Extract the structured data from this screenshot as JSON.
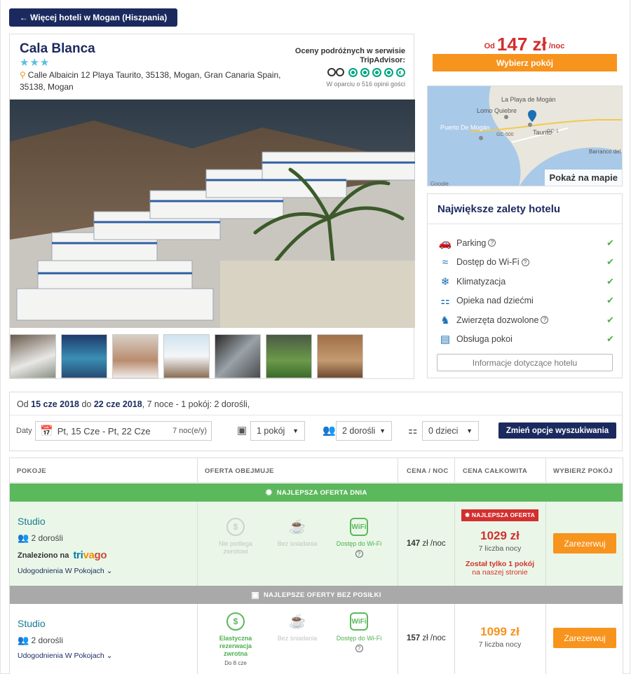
{
  "nav": {
    "back_label": "← Więcej hoteli w Mogan (Hiszpania)"
  },
  "hotel": {
    "name": "Cala Blanca",
    "stars": "★★★",
    "address": "Calle Albaicin 12 Playa Taurito, 35138, Mogan, Gran Canaria Spain, 35138, Mogan",
    "tripadvisor_title": "Oceny podróżnych w serwisie TripAdvisor:",
    "tripadvisor_rating": 4.5,
    "tripadvisor_sub": "W oparciu o 516 opinii gości"
  },
  "price_panel": {
    "prefix": "Od",
    "amount": "147 zł",
    "suffix": "/noc",
    "choose_label": "Wybierz pokój"
  },
  "map": {
    "show_label": "Pokaż na mapie",
    "labels": [
      "La Playa de Mogán",
      "Lomo Quiebre",
      "Puerto De Mogán",
      "Taurito",
      "Barranco del Cura",
      "GC-500",
      "GC-1",
      "Google"
    ]
  },
  "features": {
    "title": "Największe zalety hotelu",
    "items": [
      {
        "icon": "car-icon",
        "label": "Parking",
        "help": true
      },
      {
        "icon": "wifi-icon",
        "label": "Dostęp do Wi-Fi",
        "help": true
      },
      {
        "icon": "snowflake-icon",
        "label": "Klimatyzacja",
        "help": false
      },
      {
        "icon": "stroller-icon",
        "label": "Opieka nad dziećmi",
        "help": false
      },
      {
        "icon": "dog-icon",
        "label": "Zwierzęta dozwolone",
        "help": true
      },
      {
        "icon": "room-service-icon",
        "label": "Obsługa pokoi",
        "help": false
      }
    ],
    "info_button": "Informacje dotyczące hotelu"
  },
  "search": {
    "summary_prefix": "Od",
    "from_date": "15 cze 2018",
    "to_word": "do",
    "to_date": "22 cze 2018",
    "summary_rest": ", 7 noce - 1 pokój: 2 dorośli,",
    "dates_label": "Daty",
    "dates_value": "Pt, 15 Cze - Pt, 22 Cze",
    "nights_value": "7 noc(e/y)",
    "rooms_value": "1 pokój",
    "adults_value": "2 dorośli",
    "children_value": "0 dzieci",
    "change_button": "Zmień opcje wyszukiwania"
  },
  "table": {
    "headers": [
      "POKOJE",
      "OFERTA OBEJMUJE",
      "CENA / NOC",
      "CENA CAŁKOWITA",
      "WYBIERZ POKÓJ"
    ],
    "band_best_day": "NAJLEPSZA OFERTA DNIA",
    "band_no_meal": "NAJLEPSZE OFERTY BEZ POSIŁKI",
    "rows": [
      {
        "room": "Studio",
        "people": "2 dorośli",
        "found_on": "Znaleziono na",
        "found_brand": "trivago",
        "amenities_link": "Udogodnienia W Pokojach",
        "offer1": "Nie podlega zwrotowi",
        "offer2": "Bez śniadania",
        "offer3": "Dostęp do Wi-Fi",
        "price_night": "147",
        "price_night_unit": "zł /noc",
        "best_tag": "NAJLEPSZA OFERTA",
        "total": "1029 zł",
        "nights": "7 liczba nocy",
        "only_left": "Został tylko 1 pokój",
        "on_site": "na naszej stronie",
        "book": "Zarezerwuj"
      },
      {
        "room": "Studio",
        "people": "2 dorośli",
        "amenities_link": "Udogodnienia W Pokojach",
        "offer1": "Elastyczna rezerwacja zwrotna",
        "offer1_sub": "Do 8 cze",
        "offer2": "Bez śniadania",
        "offer3": "Dostęp do Wi-Fi",
        "price_night": "157",
        "price_night_unit": "zł /noc",
        "total": "1099 zł",
        "nights": "7 liczba nocy",
        "book": "Zarezerwuj"
      }
    ]
  },
  "colors": {
    "navy": "#1b2a5e",
    "orange": "#f7941d",
    "green": "#5cb85c",
    "red": "#d32f2f",
    "teal": "#1a7a92"
  }
}
